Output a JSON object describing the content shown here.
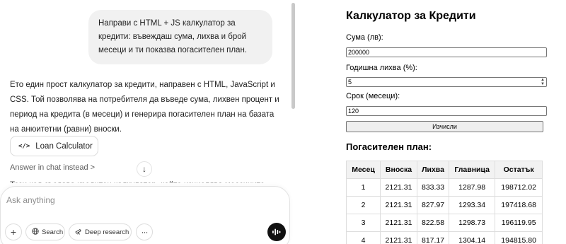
{
  "chat": {
    "user_message": "Направи с HTML + JS калкулатор за кредити: въвеждаш сума, лихва и брой месеци и ти показва погасителен план.",
    "assistant_message": "Ето един прост калкулатор за кредити, направен с HTML, JavaScript и CSS. Той позволява на потребителя да въведе сума, лихвен процент и период на кредита (в месеци) и генерира погасителен план на базата на анюитетни (равни) вноски.",
    "canvas_chip": {
      "icon": "</>",
      "label": "Loan Calculator"
    },
    "answer_in_chat": "Answer in chat instead",
    "answer_chevron": ">",
    "scroll_down_icon": "↓",
    "cut_off_line": "Този код създава кредитен калкулатор, който изчислява месечните"
  },
  "composer": {
    "placeholder": "Ask anything",
    "plus_icon": "+",
    "search_label": "Search",
    "deep_research_label": "Deep research",
    "more_icon": "···"
  },
  "preview": {
    "title": "Калкулатор за Кредити",
    "amount_label": "Сума (лв):",
    "amount_value": "200000",
    "rate_label": "Годишна лихва (%):",
    "rate_value": "5",
    "term_label": "Срок (месеци):",
    "term_value": "120",
    "calc_button": "Изчисли",
    "plan_title": "Погасителен план:",
    "table": {
      "headers": [
        "Месец",
        "Вноска",
        "Лихва",
        "Главница",
        "Остатък"
      ],
      "rows": [
        [
          "1",
          "2121.31",
          "833.33",
          "1287.98",
          "198712.02"
        ],
        [
          "2",
          "2121.31",
          "827.97",
          "1293.34",
          "197418.68"
        ],
        [
          "3",
          "2121.31",
          "822.58",
          "1298.73",
          "196119.95"
        ],
        [
          "4",
          "2121.31",
          "817.17",
          "1304.14",
          "194815.80"
        ]
      ]
    }
  }
}
